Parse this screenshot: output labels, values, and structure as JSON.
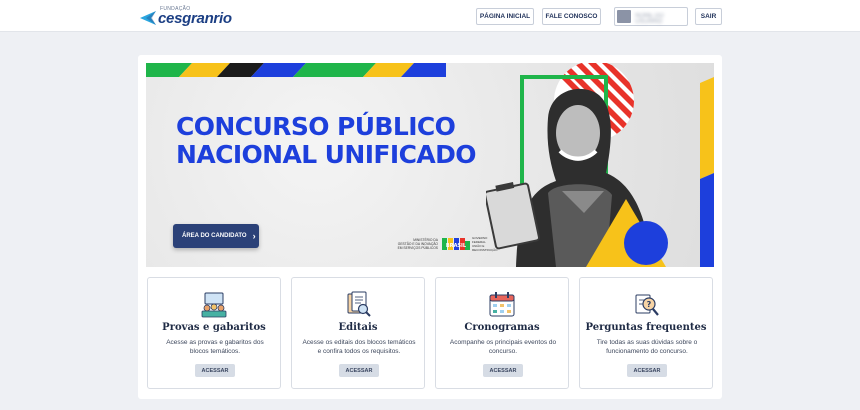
{
  "header": {
    "logo_small": "FUNDAÇÃO",
    "logo_name": "cesgranrio",
    "nav": {
      "home_label": "PÁGINA INICIAL",
      "contact_label": "FALE CONOSCO",
      "user_name": "NOME DO USUÁRIO",
      "logout_label": "SAIR"
    }
  },
  "banner": {
    "title_line1": "CONCURSO PÚBLICO",
    "title_line2": "NACIONAL UNIFICADO",
    "cta_label": "ÁREA DO CANDIDATO",
    "gov_left": [
      "MINISTÉRIO DA",
      "GESTÃO E DA INOVAÇÃO",
      "EM SERVIÇOS PÚBLICOS"
    ],
    "gov_right": [
      "GOVERNO FEDERAL",
      "UNIÃO E RECONSTRUÇÃO"
    ],
    "gov_mark": "BRASIL",
    "colors": {
      "blue": "#1d3fdc",
      "yellow": "#f7c21a",
      "green": "#1fb54a",
      "red": "#e8332a",
      "navy": "#2b4178"
    }
  },
  "cards": [
    {
      "icon": "people-board-icon",
      "title": "Provas e gabaritos",
      "desc": "Acesse as provas e gabaritos dos blocos temáticos.",
      "button": "ACESSAR"
    },
    {
      "icon": "document-search-icon",
      "title": "Editais",
      "desc": "Acesse os editais dos blocos temáticos e confira todos os requisitos.",
      "button": "ACESSAR"
    },
    {
      "icon": "calendar-icon",
      "title": "Cronogramas",
      "desc": "Acompanhe os principais eventos do concurso.",
      "button": "ACESSAR"
    },
    {
      "icon": "question-magnifier-icon",
      "title": "Perguntas frequentes",
      "desc": "Tire todas as suas dúvidas sobre o funcionamento do concurso.",
      "button": "ACESSAR"
    }
  ]
}
